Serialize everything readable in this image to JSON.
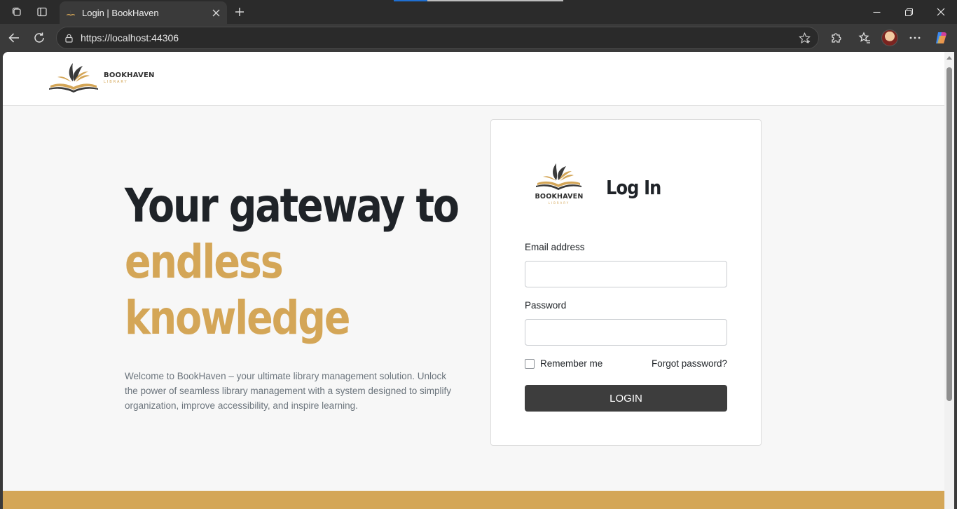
{
  "browser": {
    "tab": {
      "title": "Login | BookHaven"
    },
    "address_bar": {
      "url": "https://localhost:44306"
    },
    "icons": {
      "workspaces": "workspaces-icon",
      "tab_actions": "vertical-tabs-icon",
      "close_tab": "close-icon",
      "new_tab": "plus-icon",
      "back": "back-arrow-icon",
      "refresh": "refresh-icon",
      "lock": "lock-icon",
      "favorite": "star-icon",
      "extensions": "puzzle-icon",
      "favorites": "favorites-icon",
      "more": "more-icon",
      "copilot": "copilot-icon",
      "minimize": "minimize-icon",
      "restore": "restore-icon",
      "close_window": "close-icon"
    }
  },
  "header": {
    "logo": {
      "name": "BOOKHAVEN",
      "subtitle": "LIBRARY"
    }
  },
  "hero": {
    "line1": "Your gateway to",
    "line2": "endless",
    "line3": "knowledge",
    "description": "Welcome to BookHaven – your ultimate library management solution. Unlock the power of seamless library management with a system designed to simplify organization, improve accessibility, and inspire learning."
  },
  "login_card": {
    "logo": {
      "name": "BOOKHAVEN",
      "subtitle": "LIBRARY"
    },
    "title": "Log In",
    "email": {
      "label": "Email address",
      "value": ""
    },
    "password": {
      "label": "Password",
      "value": ""
    },
    "remember_me": {
      "label": "Remember me",
      "checked": false
    },
    "forgot_password": "Forgot password?",
    "submit_label": "LOGIN"
  },
  "colors": {
    "accent_gold": "#d4a657",
    "dark_button": "#3d3d3d",
    "heading_dark": "#1f2328",
    "muted_text": "#6c757d"
  }
}
